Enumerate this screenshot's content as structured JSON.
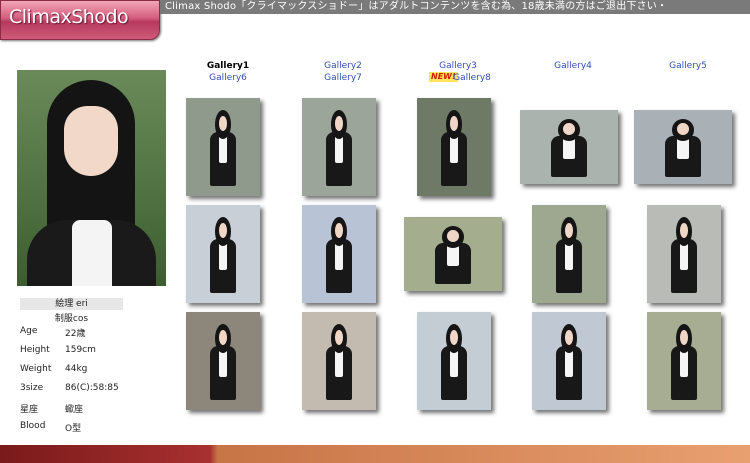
{
  "header": {
    "logo_text": "ClimaxShodo",
    "notice": "Climax Shodo「クライマックスショドー」はアダルトコンテンツを含む為、18歳未満の方はご退出下さい・"
  },
  "profile": {
    "name": "絵理 eri",
    "subtitle": "制服cos",
    "stats": [
      {
        "label": "Age",
        "value": "22歳"
      },
      {
        "label": "Height",
        "value": "159cm"
      },
      {
        "label": "Weight",
        "value": "44kg"
      },
      {
        "label": "3size",
        "value": "86(C):58:85"
      },
      {
        "label": "星座",
        "value": "蠍座"
      },
      {
        "label": "Blood",
        "value": "O型"
      }
    ]
  },
  "gallery_nav": [
    {
      "label": "Gallery1",
      "active": true
    },
    {
      "label": "Gallery2",
      "active": false
    },
    {
      "label": "Gallery3",
      "active": false
    },
    {
      "label": "Gallery4",
      "active": false
    },
    {
      "label": "Gallery5",
      "active": false
    },
    {
      "label": "Gallery6",
      "active": false
    },
    {
      "label": "Gallery7",
      "active": false
    },
    {
      "label": "Gallery8",
      "active": false,
      "badge": "NEW!"
    }
  ],
  "thumbnails": [
    {
      "bg": "#8f9a8c"
    },
    {
      "bg": "#9ca59a"
    },
    {
      "bg": "#6f7a66"
    },
    {
      "bg": "#aab3ad"
    },
    {
      "bg": "#a9b0b6"
    },
    {
      "bg": "#c9cfd6"
    },
    {
      "bg": "#b8c4d6"
    },
    {
      "bg": "#a4ad8e"
    },
    {
      "bg": "#9ea78f"
    },
    {
      "bg": "#b9bcb6"
    },
    {
      "bg": "#8c877a"
    },
    {
      "bg": "#c3bab0"
    },
    {
      "bg": "#c4ccd4"
    },
    {
      "bg": "#c0c9d3"
    },
    {
      "bg": "#a7ad93"
    }
  ],
  "colors": {
    "accent_pink": "#c9486d",
    "link_blue": "#3050b0",
    "badge_yellow": "#ffe35c"
  }
}
